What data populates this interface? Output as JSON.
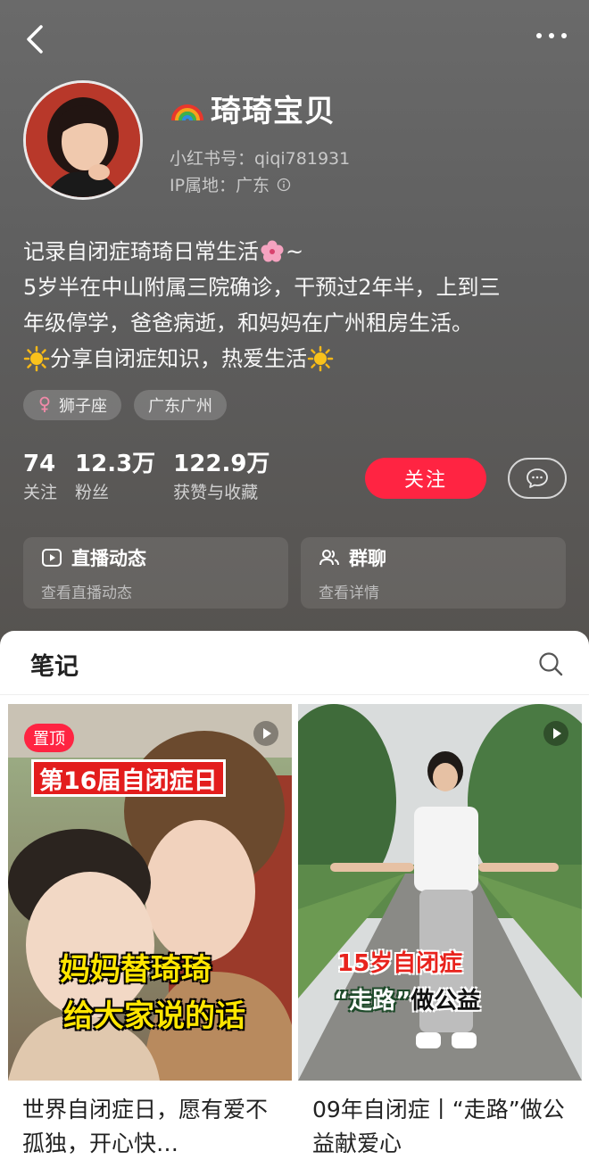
{
  "profile": {
    "username": "琦琦宝贝",
    "id_label": "小红书号：qiqi781931",
    "ip_label": "IP属地：广东",
    "bio": {
      "line1": "记录自闭症琦琦日常生活",
      "line1_suffix": "~",
      "line2": "5岁半在中山附属三院确诊，干预过2年半，上到三",
      "line3": "年级停学，爸爸病逝，和妈妈在广州租房生活。",
      "line4": "分享自闭症知识，热爱生活"
    },
    "tags": [
      "狮子座",
      "广东广州"
    ]
  },
  "stats": [
    {
      "value": "74",
      "label": "关注"
    },
    {
      "value": "12.3万",
      "label": "粉丝"
    },
    {
      "value": "122.9万",
      "label": "获赞与收藏"
    }
  ],
  "actions": {
    "follow_label": "关注"
  },
  "cards": {
    "live": {
      "title": "直播动态",
      "subtitle": "查看直播动态"
    },
    "group": {
      "title": "群聊",
      "subtitle": "查看详情"
    }
  },
  "notes": {
    "tab_title": "笔记",
    "items": [
      {
        "badge": "置顶",
        "overlay_title": "第16届自闭症日",
        "overlay_line1": "妈妈替琦琦",
        "overlay_line2": "给大家说的话",
        "caption": "世界自闭症日，愿有爱不孤独，开心快…"
      },
      {
        "overlay_line1": "15岁自闭症",
        "overlay_line2a": "“走路”",
        "overlay_line2b": "做公益",
        "caption": "09年自闭症丨“走路”做公益献爱心"
      }
    ]
  },
  "colors": {
    "accent": "#ff2442",
    "header_bg": "#5f5f5f"
  },
  "icons": {
    "back": "chevron-left-icon",
    "more": "more-dots-icon",
    "info": "info-icon",
    "female": "female-icon",
    "chat": "chat-bubble-icon",
    "live": "live-play-icon",
    "group": "group-users-icon",
    "search": "search-icon",
    "play": "video-play-icon"
  }
}
